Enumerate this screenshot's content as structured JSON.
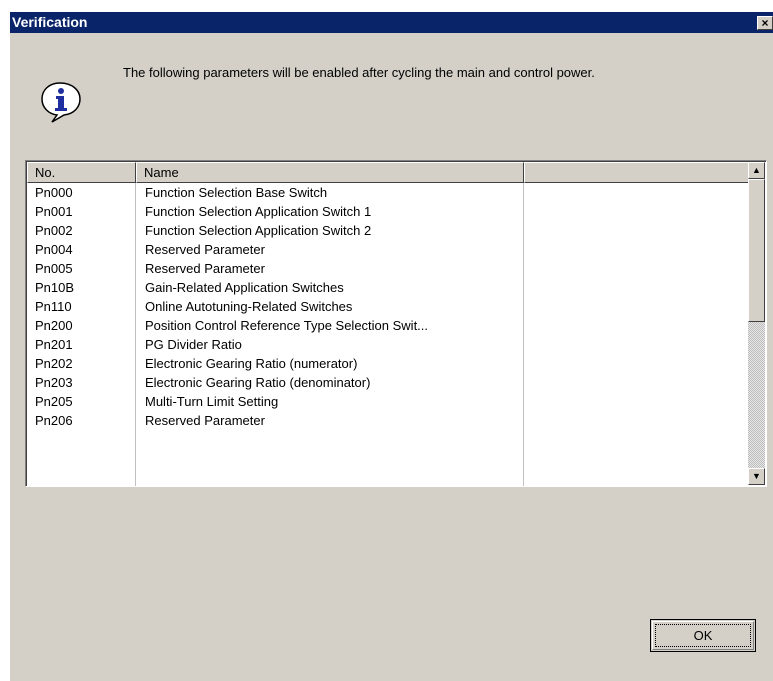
{
  "dialog": {
    "title": "Verification",
    "close_label": "×",
    "message": "The following parameters will be enabled after cycling the main and control power.",
    "ok_label": "OK"
  },
  "table": {
    "columns": [
      "No.",
      "Name",
      ""
    ],
    "rows": [
      {
        "no": "Pn000",
        "name": "Function Selection Base Switch"
      },
      {
        "no": "Pn001",
        "name": "Function Selection Application Switch 1"
      },
      {
        "no": "Pn002",
        "name": "Function Selection Application Switch 2"
      },
      {
        "no": "Pn004",
        "name": "Reserved Parameter"
      },
      {
        "no": "Pn005",
        "name": "Reserved Parameter"
      },
      {
        "no": "Pn10B",
        "name": "Gain-Related Application Switches"
      },
      {
        "no": "Pn110",
        "name": "Online Autotuning-Related Switches"
      },
      {
        "no": "Pn200",
        "name": "Position Control Reference Type Selection Swit..."
      },
      {
        "no": "Pn201",
        "name": "PG Divider Ratio"
      },
      {
        "no": "Pn202",
        "name": "Electronic Gearing Ratio (numerator)"
      },
      {
        "no": "Pn203",
        "name": "Electronic Gearing Ratio (denominator)"
      },
      {
        "no": "Pn205",
        "name": "Multi-Turn Limit Setting"
      },
      {
        "no": "Pn206",
        "name": "Reserved Parameter"
      }
    ]
  },
  "icons": {
    "info": "info-icon",
    "scroll_up": "scroll-up-icon",
    "scroll_down": "scroll-down-icon"
  },
  "colors": {
    "titlebar": "#0a246a",
    "dialog_bg": "#d4d0c8",
    "info_blue": "#1f2fa0"
  }
}
